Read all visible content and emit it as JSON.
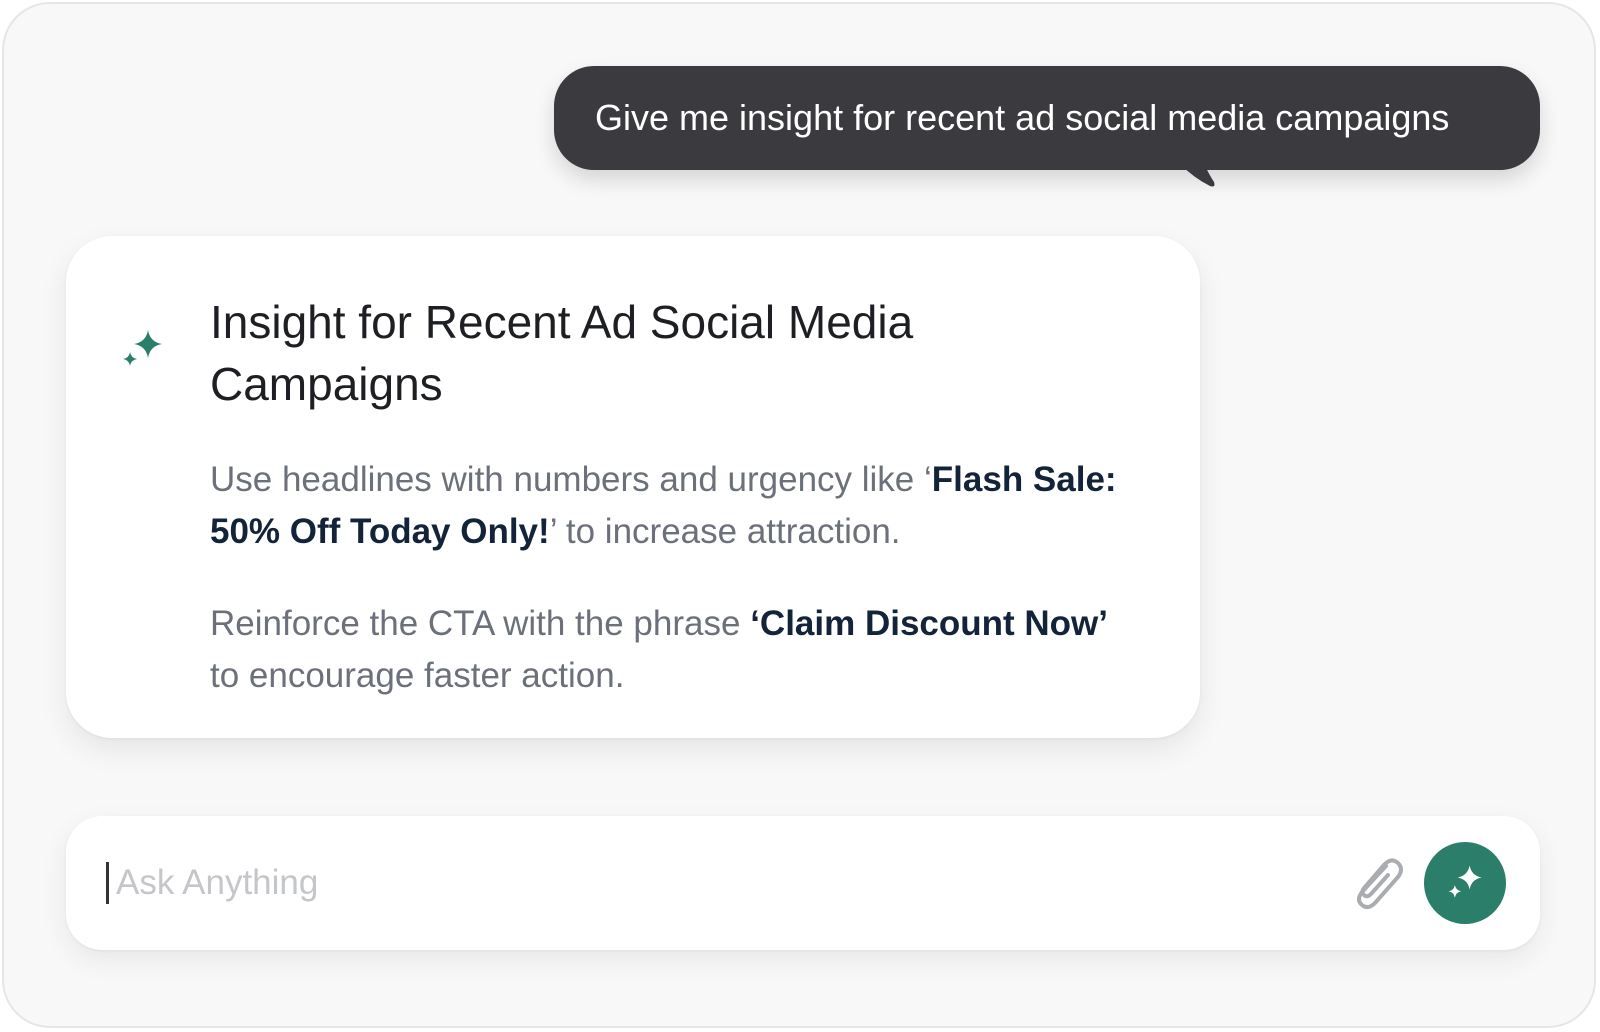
{
  "user_message": {
    "text": "Give me insight for recent ad social media campaigns"
  },
  "assistant_card": {
    "icon": "sparkle-icon",
    "title": "Insight for Recent Ad Social Media Campaigns",
    "paragraph_1": {
      "before": "Use headlines with numbers and urgency like ‘",
      "bold": "Flash Sale: 50% Off Today Only!",
      "after": "’ to increase attraction."
    },
    "paragraph_2": {
      "before": "Reinforce the CTA with the phrase ",
      "bold": "‘Claim Discount Now’",
      "after": " to encourage faster action."
    }
  },
  "composer": {
    "placeholder": "Ask Anything",
    "value": "",
    "attach_icon": "paperclip-icon",
    "send_icon": "sparkle-icon"
  },
  "colors": {
    "accent": "#2a7e6a",
    "user_bubble": "#3a3a3f",
    "body_text": "#6b707a",
    "emphasis_text": "#13233a",
    "background": "#f8f8f8"
  }
}
